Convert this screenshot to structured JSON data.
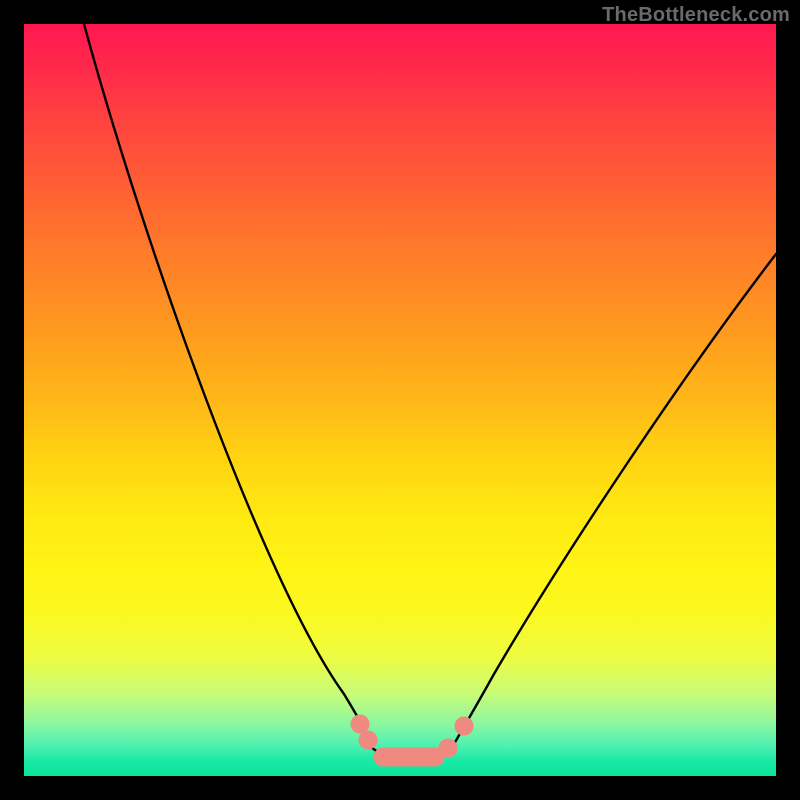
{
  "watermark": {
    "text": "TheBottleneck.com"
  },
  "chart_data": {
    "type": "line",
    "title": "",
    "xlabel": "",
    "ylabel": "",
    "xlim": [
      0,
      100
    ],
    "ylim": [
      0,
      100
    ],
    "grid": false,
    "legend": false,
    "gradient_stops": [
      {
        "pos": 0,
        "color": "#ff1750"
      },
      {
        "pos": 6,
        "color": "#ff2a4a"
      },
      {
        "pos": 12,
        "color": "#ff4040"
      },
      {
        "pos": 20,
        "color": "#ff5a36"
      },
      {
        "pos": 30,
        "color": "#ff7a2a"
      },
      {
        "pos": 40,
        "color": "#ff9820"
      },
      {
        "pos": 50,
        "color": "#ffb718"
      },
      {
        "pos": 58,
        "color": "#ffd412"
      },
      {
        "pos": 65,
        "color": "#ffe812"
      },
      {
        "pos": 72,
        "color": "#fff314"
      },
      {
        "pos": 78,
        "color": "#fcf81e"
      },
      {
        "pos": 84,
        "color": "#eefc40"
      },
      {
        "pos": 89,
        "color": "#c8fc78"
      },
      {
        "pos": 93,
        "color": "#8cf7a0"
      },
      {
        "pos": 96,
        "color": "#4ef0b0"
      },
      {
        "pos": 98,
        "color": "#18e9a8"
      },
      {
        "pos": 100,
        "color": "#0ce596"
      }
    ],
    "series": [
      {
        "name": "left-branch",
        "x": [
          8,
          12,
          17,
          23,
          29,
          35,
          39,
          43,
          45
        ],
        "y": [
          100,
          88,
          75,
          60,
          44,
          28,
          16,
          7,
          3
        ]
      },
      {
        "name": "right-branch",
        "x": [
          57,
          60,
          64,
          70,
          78,
          86,
          93,
          100
        ],
        "y": [
          3,
          7,
          14,
          24,
          37,
          50,
          60,
          70
        ]
      },
      {
        "name": "valley-floor",
        "x": [
          45,
          48,
          52,
          55,
          57
        ],
        "y": [
          3,
          1.5,
          1.5,
          1.5,
          3
        ]
      }
    ],
    "marker_band": {
      "name": "valley-marker",
      "color": "#ef8a80",
      "points": [
        {
          "x": 44.5,
          "y": 6
        },
        {
          "x": 45.5,
          "y": 2.5
        },
        {
          "x": 48,
          "y": 1.5
        },
        {
          "x": 52,
          "y": 1.5
        },
        {
          "x": 55,
          "y": 1.5
        },
        {
          "x": 57,
          "y": 3
        },
        {
          "x": 58.5,
          "y": 6
        }
      ]
    }
  }
}
